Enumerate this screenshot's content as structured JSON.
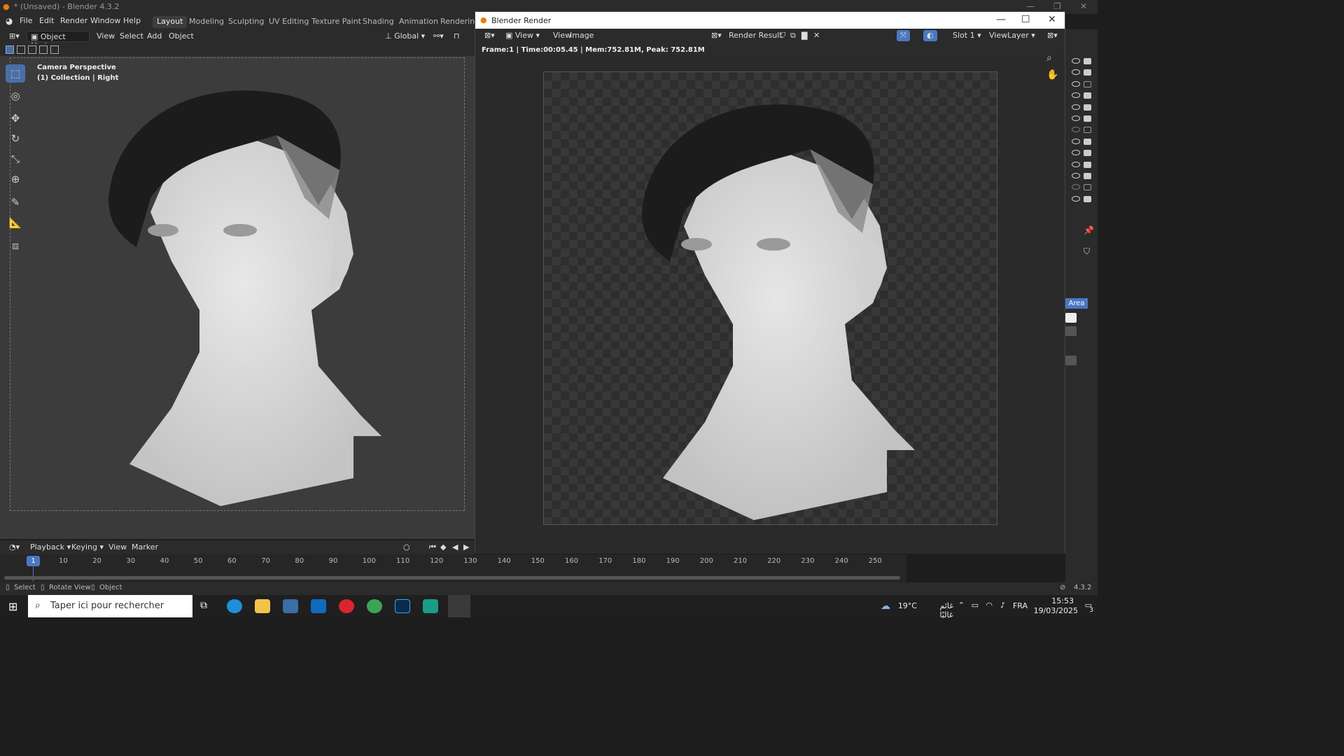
{
  "window": {
    "title": "* (Unsaved) - Blender 4.3.2"
  },
  "menu": {
    "items": [
      "File",
      "Edit",
      "Render",
      "Window",
      "Help"
    ]
  },
  "workspaces": [
    "Layout",
    "Modeling",
    "Sculpting",
    "UV Editing",
    "Texture Paint",
    "Shading",
    "Animation",
    "Rendering"
  ],
  "viewport_header": {
    "mode": "Object Mode",
    "view": "View",
    "select": "Select",
    "add": "Add",
    "object": "Object",
    "orientation": "Global"
  },
  "viewport": {
    "camera": "Camera Perspective",
    "collection": "(1) Collection | Right"
  },
  "timeline": {
    "playback": "Playback",
    "keying": "Keying",
    "view": "View",
    "marker": "Marker",
    "current_frame": "1",
    "ticks": [
      "10",
      "20",
      "30",
      "40",
      "50",
      "60",
      "70",
      "80",
      "90",
      "100",
      "110",
      "120",
      "130",
      "140",
      "150",
      "160",
      "170",
      "180",
      "190",
      "200",
      "210",
      "220",
      "230",
      "240",
      "250"
    ]
  },
  "status": {
    "select": "Select",
    "rotate": "Rotate View",
    "object": "Object",
    "version": "4.3.2"
  },
  "render_window": {
    "title": "Blender Render",
    "view": "View",
    "view2": "View",
    "image": "Image",
    "result": "Render Result",
    "slot": "Slot 1",
    "layer": "ViewLayer",
    "info": "Frame:1 | Time:00:05.45 | Mem:752.81M, Peak: 752.81M"
  },
  "right_panel": {
    "area_label": "Area"
  },
  "taskbar": {
    "search_placeholder": "Taper ici pour rechercher",
    "weather": "19°C",
    "weather_text": "غائم غالبًا",
    "lang": "FRA",
    "time": "15:53",
    "date": "19/03/2025",
    "notif": "3"
  }
}
